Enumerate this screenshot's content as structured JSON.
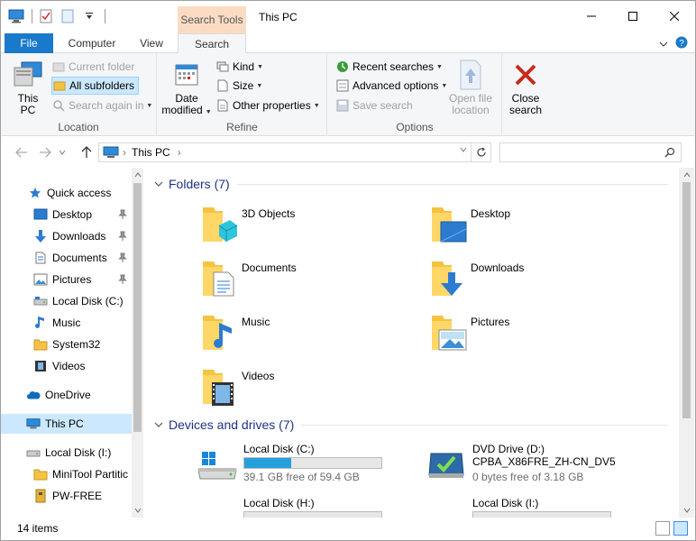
{
  "window": {
    "title": "This PC",
    "context_tab_header": "Search Tools"
  },
  "ribbon_tabs": {
    "file": "File",
    "computer": "Computer",
    "view": "View",
    "search": "Search"
  },
  "ribbon": {
    "location": {
      "label": "Location",
      "this_pc": "This PC",
      "this_pc_line1": "This",
      "this_pc_line2": "PC",
      "current_folder": "Current folder",
      "all_subfolders": "All subfolders",
      "search_again_in": "Search again in"
    },
    "refine": {
      "label": "Refine",
      "date_modified_line1": "Date",
      "date_modified_line2": "modified",
      "kind": "Kind",
      "size": "Size",
      "other_properties": "Other properties"
    },
    "options": {
      "label": "Options",
      "recent_searches": "Recent searches",
      "advanced_options": "Advanced options",
      "save_search": "Save search",
      "open_file_location_line1": "Open file",
      "open_file_location_line2": "location"
    },
    "close": {
      "close_search_line1": "Close",
      "close_search_line2": "search"
    }
  },
  "address": {
    "path_root": "This PC",
    "separator": "›"
  },
  "nav": {
    "quick_access": "Quick access",
    "items": [
      {
        "label": "Desktop",
        "pinned": true
      },
      {
        "label": "Downloads",
        "pinned": true
      },
      {
        "label": "Documents",
        "pinned": true
      },
      {
        "label": "Pictures",
        "pinned": true
      },
      {
        "label": "Local Disk (C:)",
        "pinned": false
      },
      {
        "label": "Music",
        "pinned": false
      },
      {
        "label": "System32",
        "pinned": false
      },
      {
        "label": "Videos",
        "pinned": false
      }
    ],
    "onedrive": "OneDrive",
    "this_pc": "This PC",
    "local_disk_i": "Local Disk (I:)",
    "minitool": "MiniTool Partitic",
    "pwfree": "PW-FREE"
  },
  "content": {
    "folders_header": "Folders (7)",
    "folders": [
      "3D Objects",
      "Desktop",
      "Documents",
      "Downloads",
      "Music",
      "Pictures",
      "Videos"
    ],
    "drives_header": "Devices and drives (7)",
    "drives": [
      {
        "name": "Local Disk (C:)",
        "free": "39.1 GB free of 59.4 GB",
        "used_fraction": 0.34
      },
      {
        "name": "DVD Drive (D:)",
        "name2": "CPBA_X86FRE_ZH-CN_DV5",
        "free": "0 bytes free of 3.18 GB"
      },
      {
        "name": "Local Disk (H:)"
      },
      {
        "name": "Local Disk (I:)"
      }
    ]
  },
  "status": {
    "items_count": "14 items"
  },
  "colors": {
    "accent": "#1979ca",
    "selection": "#cce8ff",
    "folder": "#f5c342",
    "progress": "#26a0da",
    "section_header": "#1e3287"
  }
}
